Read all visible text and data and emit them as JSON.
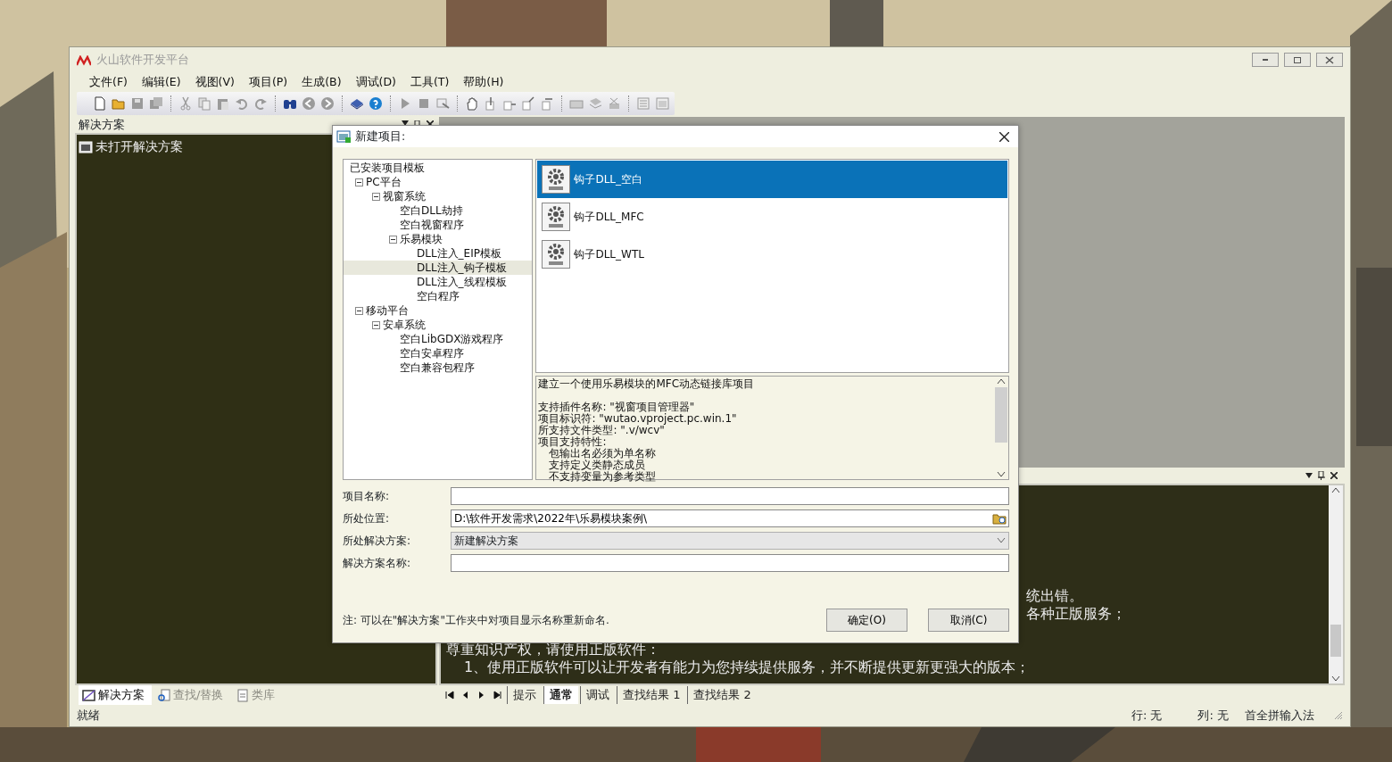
{
  "window": {
    "title": "火山软件开发平台"
  },
  "menu": [
    "文件(F)",
    "编辑(E)",
    "视图(V)",
    "项目(P)",
    "生成(B)",
    "调试(D)",
    "工具(T)",
    "帮助(H)"
  ],
  "solution_panel": {
    "title": "解决方案",
    "items": [
      {
        "label": "未打开解决方案"
      }
    ]
  },
  "left_tabs": [
    {
      "label": "解决方案",
      "selected": true
    },
    {
      "label": "查找/替换",
      "selected": false
    },
    {
      "label": "类库",
      "selected": false
    }
  ],
  "dialog": {
    "title": "新建项目:",
    "tree": [
      {
        "label": "已安装项目模板",
        "selected": false,
        "children": [
          {
            "label": "PC平台",
            "expanded": true,
            "selected": false,
            "children": [
              {
                "label": "视窗系统",
                "expanded": true,
                "selected": false,
                "children": [
                  {
                    "label": "空白DLL劫持",
                    "selected": false
                  },
                  {
                    "label": "空白视窗程序",
                    "selected": false
                  },
                  {
                    "label": "乐易模块",
                    "expanded": true,
                    "selected": false,
                    "children": [
                      {
                        "label": "DLL注入_EIP模板",
                        "selected": false
                      },
                      {
                        "label": "DLL注入_钩子模板",
                        "selected": true
                      },
                      {
                        "label": "DLL注入_线程模板",
                        "selected": false
                      },
                      {
                        "label": "空白程序",
                        "selected": false
                      }
                    ]
                  }
                ]
              }
            ]
          },
          {
            "label": "移动平台",
            "expanded": true,
            "selected": false,
            "children": [
              {
                "label": "安卓系统",
                "expanded": true,
                "selected": false,
                "children": [
                  {
                    "label": "空白LibGDX游戏程序",
                    "selected": false
                  },
                  {
                    "label": "空白安卓程序",
                    "selected": false
                  },
                  {
                    "label": "空白兼容包程序",
                    "selected": false
                  }
                ]
              }
            ]
          }
        ]
      }
    ],
    "templates": [
      {
        "label": "钩子DLL_空白",
        "selected": true
      },
      {
        "label": "钩子DLL_MFC",
        "selected": false
      },
      {
        "label": "钩子DLL_WTL",
        "selected": false
      }
    ],
    "description": [
      {
        "text": "建立一个使用乐易模块的MFC动态链接库项目",
        "kind": "summary"
      },
      {
        "text": "支持插件名称: \"视窗项目管理器\"",
        "kind": "plain"
      },
      {
        "text": "项目标识符: \"wutao.vproject.pc.win.1\"",
        "kind": "plain"
      },
      {
        "text": "所支持文件类型: \".v/wcv\"",
        "kind": "plain"
      },
      {
        "text": "项目支持特性:",
        "kind": "plain"
      },
      {
        "text": "包输出名必须为单名称",
        "kind": "indent"
      },
      {
        "text": "支持定义类静态成员",
        "kind": "indent"
      },
      {
        "text": "不支持变量为参考类型",
        "kind": "indent"
      }
    ],
    "fields": [
      {
        "label": "项目名称:",
        "kind": "text"
      },
      {
        "label": "所处位置:",
        "kind": "path",
        "value": "D:\\软件开发需求\\2022年\\乐易模块案例\\"
      },
      {
        "label": "所处解决方案:",
        "kind": "select",
        "value": "新建解决方案"
      },
      {
        "label": "解决方案名称:",
        "kind": "text"
      }
    ],
    "note": "注: 可以在\"解决方案\"工作夹中对项目显示名称重新命名.",
    "buttons": [
      "确定(O)",
      "取消(C)"
    ]
  },
  "output": {
    "lines": [
      {
        "text": "统出错。",
        "kind": "fragment"
      },
      {
        "text": "各种正版服务；",
        "kind": "fragment"
      },
      {
        "text": "尊重知识产权，请使用正版软件：",
        "kind": "heading"
      },
      {
        "text": "1、使用正版软件可以让开发者有能力为您持续提供服务，并不断提供更新更强大的版本；",
        "kind": "item"
      }
    ]
  },
  "output_tabs": [
    {
      "label": "提示",
      "selected": false
    },
    {
      "label": "通常",
      "selected": true
    },
    {
      "label": "调试",
      "selected": false
    },
    {
      "label": "查找结果 1",
      "selected": false
    },
    {
      "label": "查找结果 2",
      "selected": false
    }
  ],
  "status_bar": {
    "message": "就绪",
    "row": "行: 无",
    "column": "列: 无",
    "input_method": "首全拼输入法"
  }
}
